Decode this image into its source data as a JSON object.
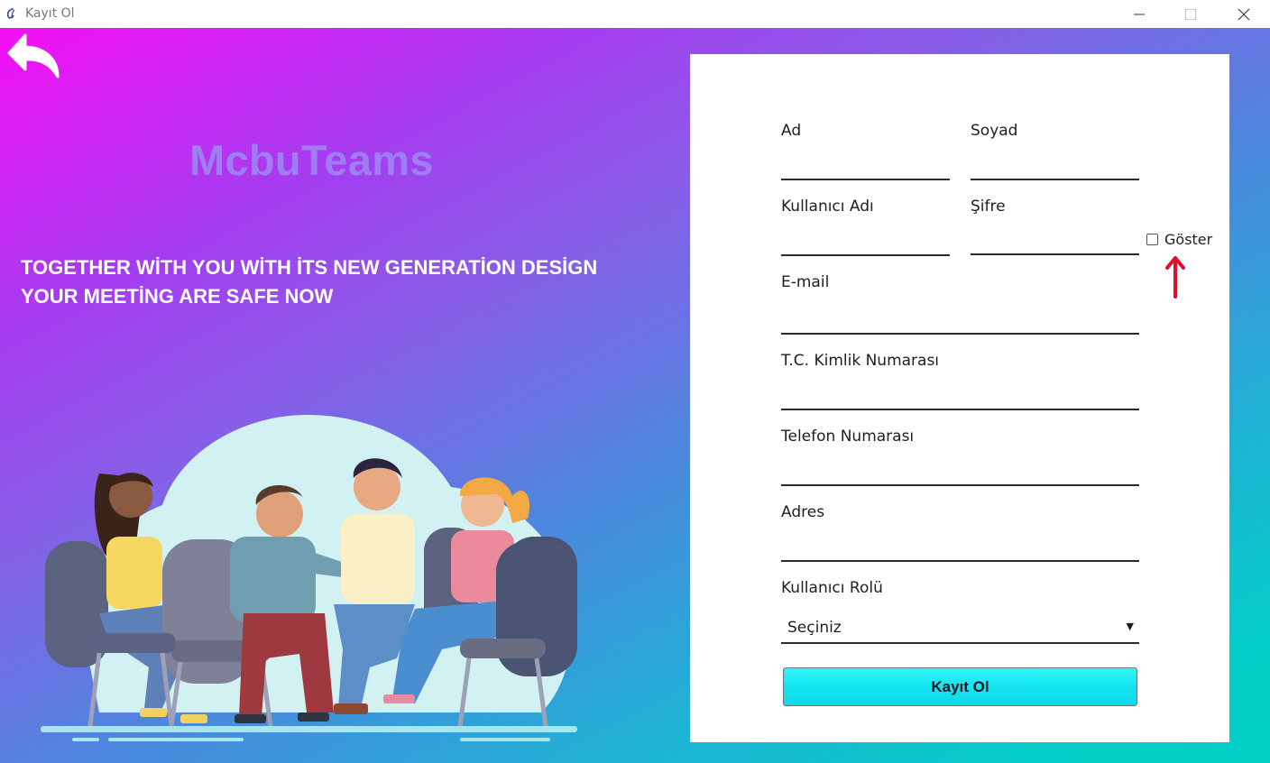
{
  "window": {
    "title": "Kayıt Ol",
    "icon": "app-logo-icon",
    "controls": [
      "minimize-icon",
      "maximize-icon",
      "close-icon"
    ]
  },
  "hero": {
    "brand": "McbuTeams",
    "tagline_line1": "TOGETHER WİTH YOU WİTH İTS NEW GENERATİON DESİGN",
    "tagline_line2": "YOUR MEETİNG ARE SAFE NOW",
    "back_icon": "back-arrow-icon"
  },
  "form": {
    "first_name": {
      "label": "Ad",
      "value": ""
    },
    "last_name": {
      "label": "Soyad",
      "value": ""
    },
    "username": {
      "label": "Kullanıcı Adı",
      "value": ""
    },
    "password": {
      "label": "Şifre",
      "value": ""
    },
    "show_password": {
      "label": "Göster",
      "checked": false
    },
    "email": {
      "label": "E-mail",
      "value": ""
    },
    "tc_number": {
      "label": "T.C. Kimlik Numarası",
      "value": ""
    },
    "phone": {
      "label": "Telefon Numarası",
      "value": ""
    },
    "address": {
      "label": "Adres",
      "value": ""
    },
    "role": {
      "label": "Kullanıcı Rolü",
      "selected": "Seçiniz"
    },
    "submit_label": "Kayıt Ol"
  },
  "colors": {
    "gradient_start": "#f50ff5",
    "gradient_end": "#00d0c6",
    "brand_text": "#9e7ef2",
    "button": "#14e4f0",
    "annotation_arrow": "#e0102a"
  }
}
